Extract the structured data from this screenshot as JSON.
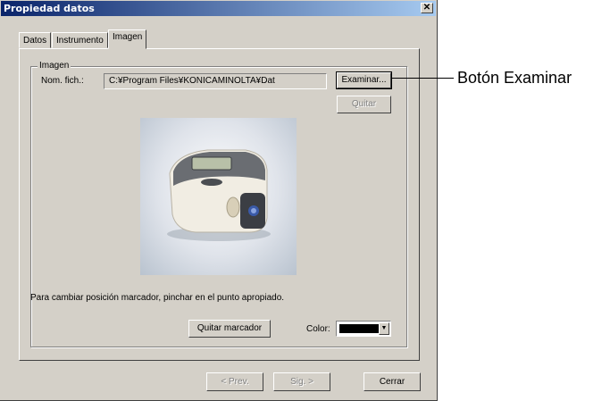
{
  "window": {
    "title": "Propiedad datos",
    "close_glyph": "✕"
  },
  "tabs": [
    {
      "label": "Datos"
    },
    {
      "label": "Instrumento"
    },
    {
      "label": "Imagen",
      "active": true
    }
  ],
  "image_group": {
    "legend": "Imagen",
    "filename_label": "Nom. fich.:",
    "filename_value": "C:¥Program Files¥KONICAMINOLTA¥Dat",
    "browse_button": "Examinar...",
    "remove_button": "Quitar",
    "instruction": "Para cambiar posición marcador, pinchar en el punto apropiado.",
    "remove_marker_button": "Quitar marcador",
    "color_label": "Color:",
    "color_value": "#000000"
  },
  "footer": {
    "prev_button": "< Prev.",
    "next_button": "Sig. >",
    "close_button": "Cerrar"
  },
  "callout": {
    "text": "Botón Examinar"
  },
  "icons": {
    "dropdown": "chevron-down-icon",
    "close": "close-icon"
  }
}
